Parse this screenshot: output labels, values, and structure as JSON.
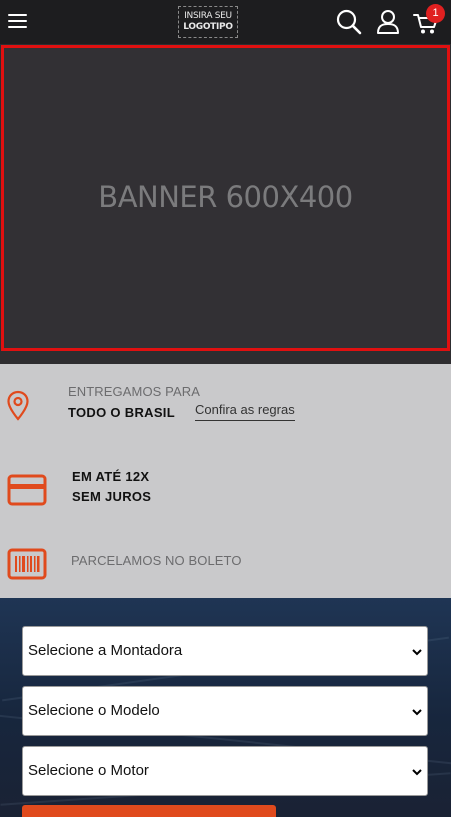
{
  "header": {
    "logo_line1": "INSIRA SEU",
    "logo_line2": "LOGOTIPO",
    "cart_count": "1",
    "icons": [
      "menu-icon",
      "search-icon",
      "user-icon",
      "cart-icon"
    ]
  },
  "banner": {
    "text": "BANNER 600X400",
    "border_color": "#e01010"
  },
  "info": {
    "delivery_label": "ENTREGAMOS PARA",
    "delivery_value": "TODO O BRASIL",
    "rules_link": "Confira as regras",
    "installments_line1": "EM ATÉ 12X",
    "installments_line2": "SEM JUROS",
    "boleto_text": "PARCELAMOS NO BOLETO",
    "icons": [
      "location-pin-icon",
      "credit-card-icon",
      "barcode-icon"
    ],
    "accent_color": "#e04a1d"
  },
  "filter": {
    "make_select": "Selecione a Montadora",
    "model_select": "Selecione o Modelo",
    "engine_select": "Selecione o Motor"
  }
}
